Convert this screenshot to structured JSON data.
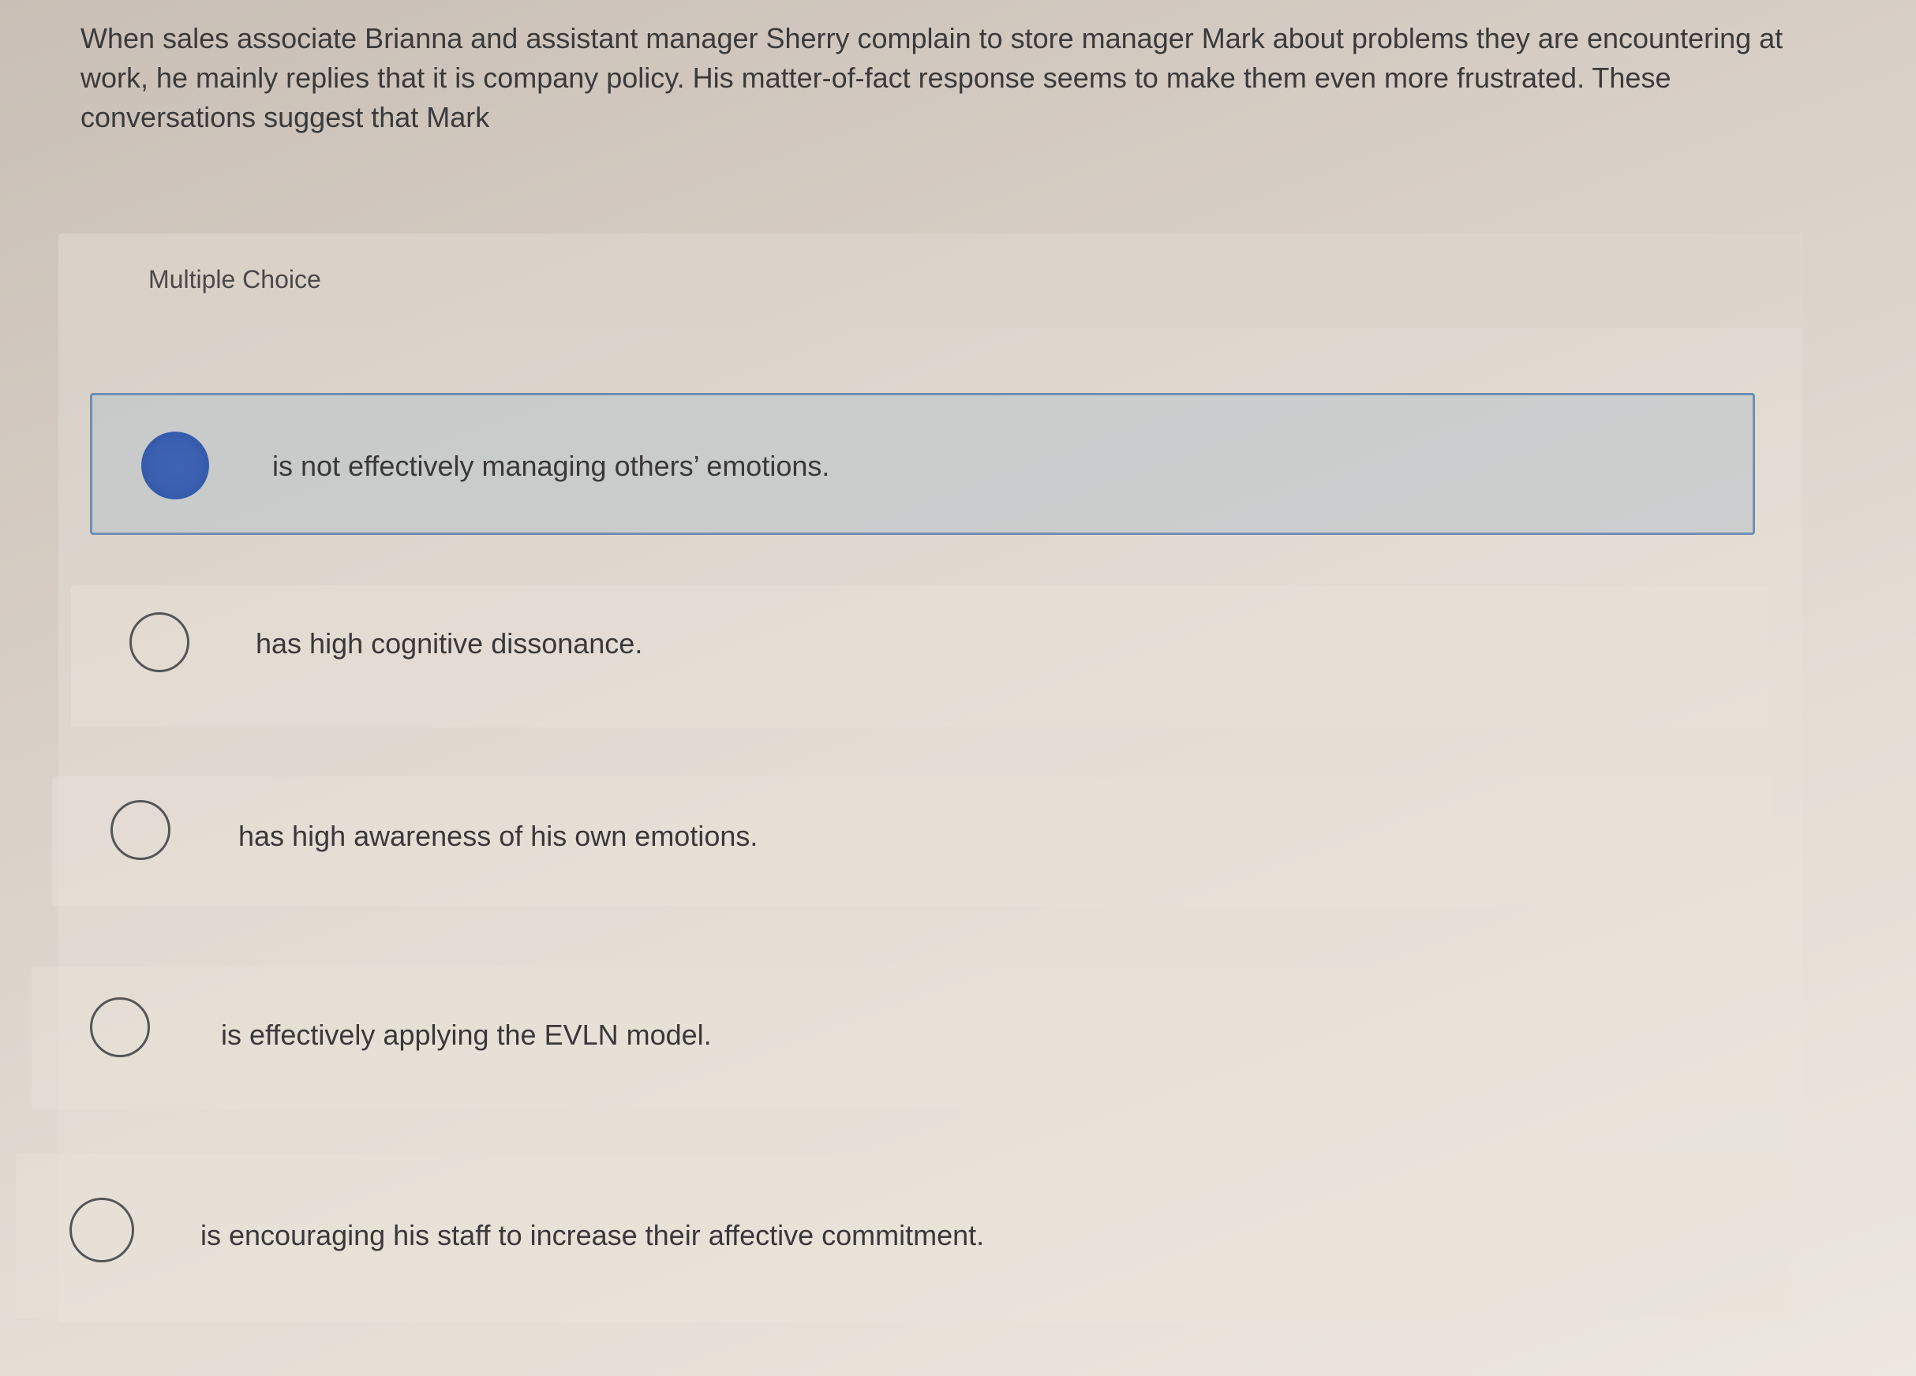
{
  "question": {
    "text": "When sales associate Brianna and assistant manager Sherry complain to store manager Mark about problems they are encountering at work, he mainly replies that it is company policy. His matter-of-fact response seems to make them even more frustrated. These conversations suggest that Mark"
  },
  "multiple_choice": {
    "label": "Multiple Choice",
    "selected_index": 0,
    "options": [
      {
        "label": "is not effectively managing others’ emotions.",
        "selected": true
      },
      {
        "label": "has high cognitive dissonance.",
        "selected": false
      },
      {
        "label": "has high awareness of his own emotions.",
        "selected": false
      },
      {
        "label": "is effectively applying the EVLN model.",
        "selected": false
      },
      {
        "label": "is encouraging his staff to increase their affective commitment.",
        "selected": false
      }
    ]
  },
  "colors": {
    "selected_radio": "#3a5fb0",
    "selected_border": "#6f8eb3",
    "text": "#3a3838"
  }
}
